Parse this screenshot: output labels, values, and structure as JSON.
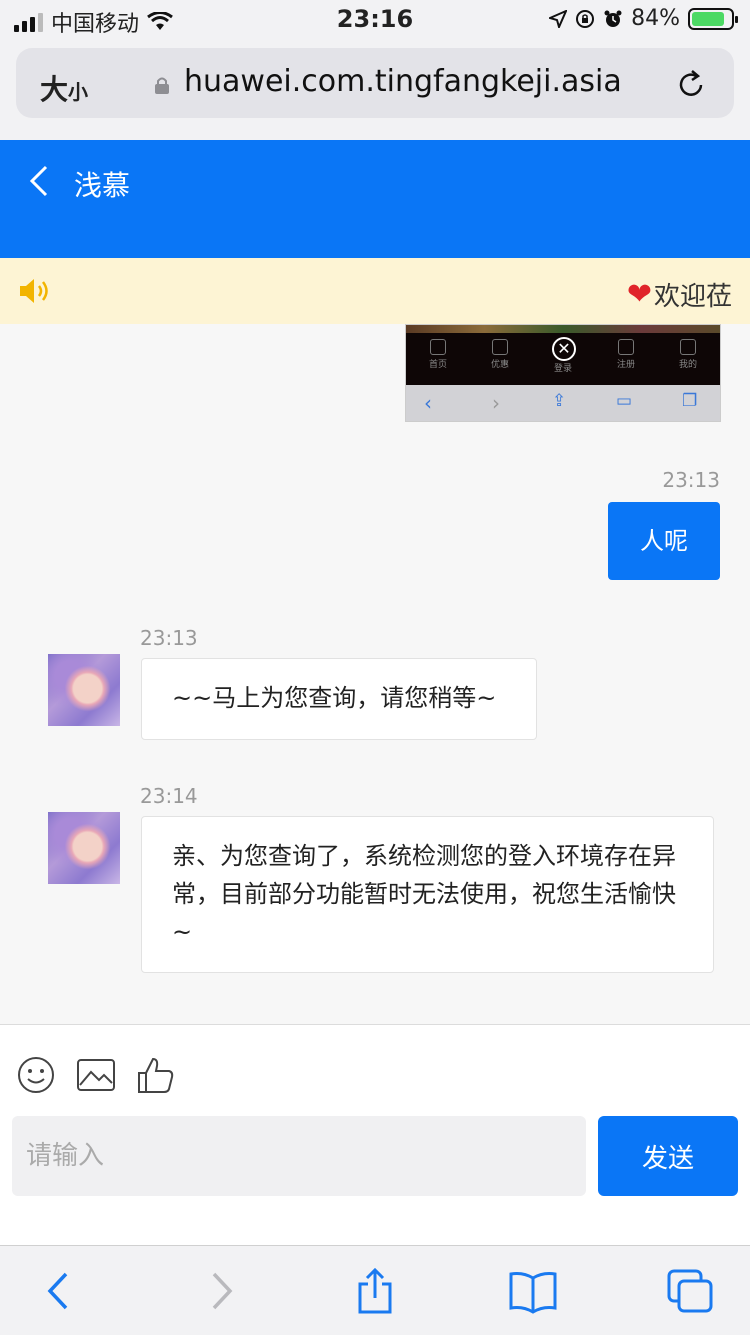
{
  "status_bar": {
    "carrier": "中国移动",
    "time": "23:16",
    "battery": "84%"
  },
  "browser": {
    "text_size_label": "大",
    "text_size_small": "小",
    "url": "huawei.com.tingfangkeji.asia"
  },
  "header": {
    "title": "浅慕"
  },
  "notice": {
    "text": "欢迎莅"
  },
  "image_message": {
    "tabs": [
      "首页",
      "优惠",
      "登录",
      "注册",
      "我的"
    ]
  },
  "messages": [
    {
      "side": "right",
      "time": "23:13",
      "text": "人呢"
    },
    {
      "side": "left",
      "time": "23:13",
      "text": "~~马上为您查询，请您稍等~"
    },
    {
      "side": "left",
      "time": "23:14",
      "text": "亲、为您查询了，系统检测您的登入环境存在异常，目前部分功能暂时无法使用，祝您生活愉快~"
    }
  ],
  "composer": {
    "placeholder": "请输入",
    "send_label": "发送"
  },
  "colors": {
    "primary": "#0a76f6",
    "notice_bg": "#fdf4d4"
  }
}
